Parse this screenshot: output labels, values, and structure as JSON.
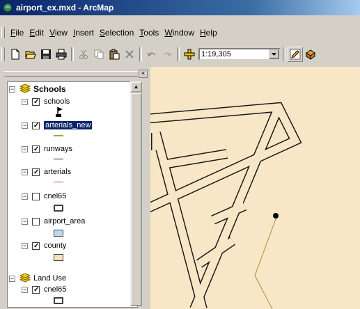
{
  "window": {
    "title": "airport_ex.mxd - ArcMap"
  },
  "menu": {
    "items": [
      {
        "label": "File",
        "accel": "F",
        "rest": "ile"
      },
      {
        "label": "Edit",
        "accel": "E",
        "rest": "dit"
      },
      {
        "label": "View",
        "accel": "V",
        "rest": "iew"
      },
      {
        "label": "Insert",
        "accel": "I",
        "rest": "nsert"
      },
      {
        "label": "Selection",
        "accel": "S",
        "rest": "election"
      },
      {
        "label": "Tools",
        "accel": "T",
        "rest": "ools"
      },
      {
        "label": "Window",
        "accel": "W",
        "rest": "indow"
      },
      {
        "label": "Help",
        "accel": "H",
        "rest": "elp"
      }
    ]
  },
  "toolbar": {
    "scale_value": "1:19,305"
  },
  "toc": {
    "close_label": "×",
    "groups": [
      {
        "name": "Schools",
        "expanded": true,
        "layers": [
          {
            "name": "schools",
            "checked": true,
            "selected": false,
            "symbol": "flag"
          },
          {
            "name": "arterials_new",
            "checked": true,
            "selected": true,
            "symbol": "line",
            "color": "#a8a040"
          },
          {
            "name": "runways",
            "checked": true,
            "selected": false,
            "symbol": "line",
            "color": "#202020"
          },
          {
            "name": "arterials",
            "checked": true,
            "selected": false,
            "symbol": "line",
            "color": "#c04040"
          },
          {
            "name": "cnel65",
            "checked": false,
            "selected": false,
            "symbol": "hollow-box"
          },
          {
            "name": "airport_area",
            "checked": false,
            "selected": false,
            "symbol": "fill-box",
            "color": "#bcd8f0"
          },
          {
            "name": "county",
            "checked": true,
            "selected": false,
            "symbol": "fill-box",
            "color": "#f7e2bc"
          }
        ]
      },
      {
        "name": "Land Use",
        "expanded": true,
        "layers": [
          {
            "name": "cnel65",
            "checked": true,
            "selected": false,
            "symbol": "hollow-box"
          }
        ]
      }
    ]
  },
  "colors": {
    "map_background": "#f7e7c6",
    "road_casing": "#1a1a1a",
    "road_fill": "#f7e7c6",
    "arterial_line": "#b08a3a"
  }
}
